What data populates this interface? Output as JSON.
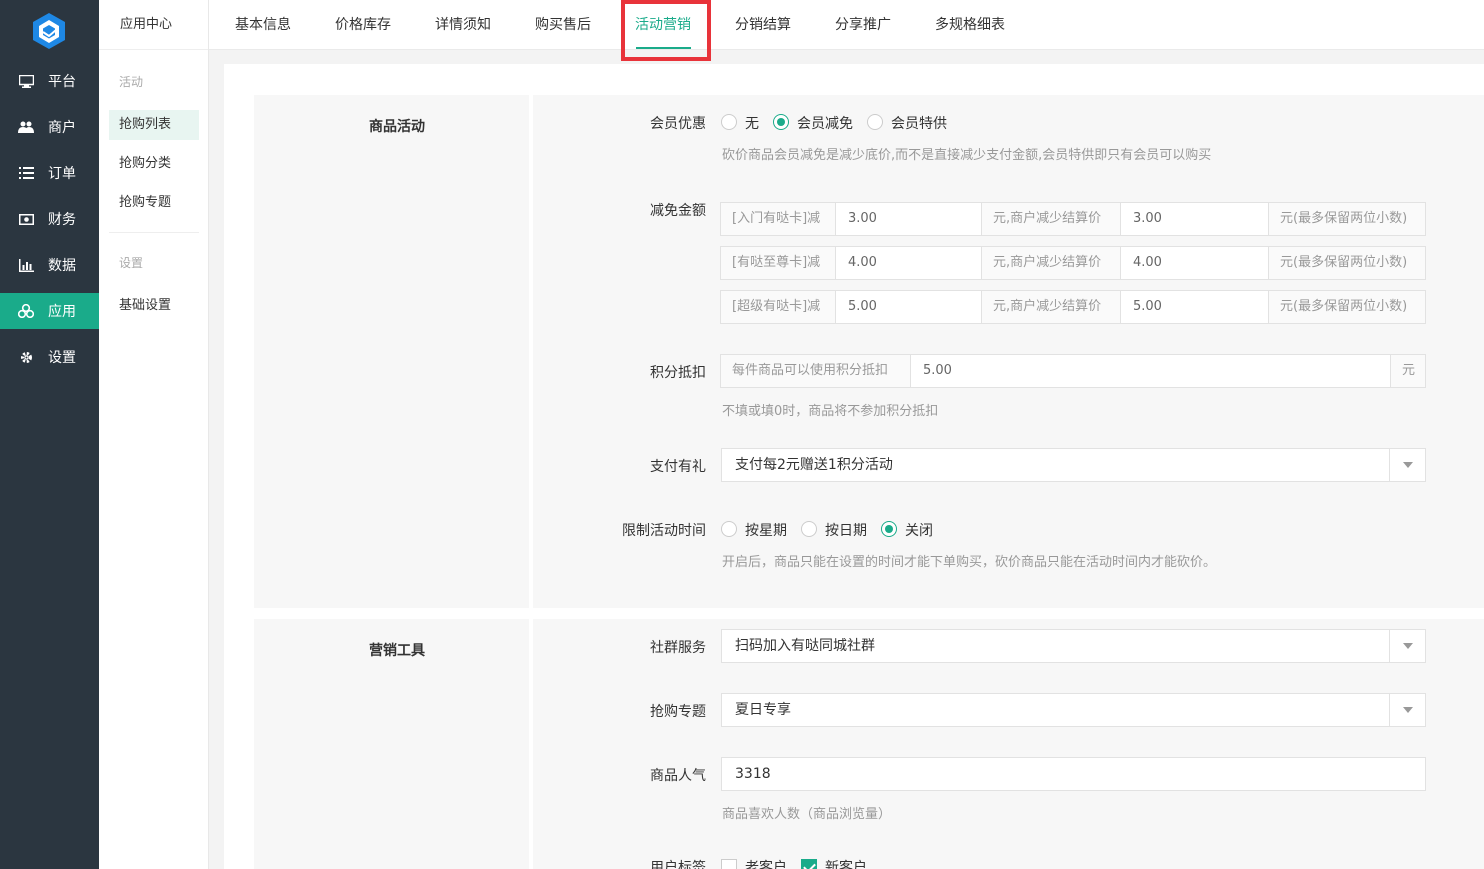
{
  "sidebar": {
    "items": [
      {
        "label": "平台",
        "icon": "monitor-icon"
      },
      {
        "label": "商户",
        "icon": "users-icon"
      },
      {
        "label": "订单",
        "icon": "list-icon"
      },
      {
        "label": "财务",
        "icon": "money-icon"
      },
      {
        "label": "数据",
        "icon": "bar-chart-icon"
      },
      {
        "label": "应用",
        "icon": "apps-icon",
        "active": true
      },
      {
        "label": "设置",
        "icon": "gear-icon"
      }
    ],
    "accent": "#1aab8a"
  },
  "subnav": {
    "title": "应用中心",
    "group1": "活动",
    "items1": [
      "抢购列表",
      "抢购分类",
      "抢购专题"
    ],
    "group2": "设置",
    "items2": [
      "基础设置"
    ]
  },
  "tabs": [
    "基本信息",
    "价格库存",
    "详情须知",
    "购买售后",
    "活动营销",
    "分销结算",
    "分享推广",
    "多规格细表"
  ],
  "activeTab": "活动营销",
  "section1": {
    "title": "商品活动",
    "member": {
      "label": "会员优惠",
      "options": [
        "无",
        "会员减免",
        "会员特供"
      ],
      "selected": "会员减免",
      "help": "砍价商品会员减免是减少底价,而不是直接减少支付金额,会员特供即只有会员可以购买"
    },
    "discount": {
      "label": "减免金额",
      "rows": [
        {
          "card": "[入门有哒卡]减",
          "amount": "3.00",
          "mid": "元,商户减少结算价",
          "settle": "3.00",
          "tail": "元(最多保留两位小数)"
        },
        {
          "card": "[有哒至尊卡]减",
          "amount": "4.00",
          "mid": "元,商户减少结算价",
          "settle": "4.00",
          "tail": "元(最多保留两位小数)"
        },
        {
          "card": "[超级有哒卡]减",
          "amount": "5.00",
          "mid": "元,商户减少结算价",
          "settle": "5.00",
          "tail": "元(最多保留两位小数)"
        }
      ]
    },
    "points": {
      "label": "积分抵扣",
      "prefix": "每件商品可以使用积分抵扣",
      "value": "5.00",
      "unit": "元",
      "help": "不填或填0时，商品将不参加积分抵扣"
    },
    "gift": {
      "label": "支付有礼",
      "value": "支付每2元赠送1积分活动"
    },
    "timeLimit": {
      "label": "限制活动时间",
      "options": [
        "按星期",
        "按日期",
        "关闭"
      ],
      "selected": "关闭",
      "help": "开启后，商品只能在设置的时间才能下单购买，砍价商品只能在活动时间内才能砍价。"
    }
  },
  "section2": {
    "title": "营销工具",
    "community": {
      "label": "社群服务",
      "value": "扫码加入有哒同城社群"
    },
    "topic": {
      "label": "抢购专题",
      "value": "夏日专享"
    },
    "popularity": {
      "label": "商品人气",
      "value": "3318",
      "help": "商品喜欢人数（商品浏览量）"
    },
    "userTag": {
      "label": "用户标签",
      "options": [
        "老客户",
        "新客户"
      ],
      "checked": [
        "新客户"
      ]
    }
  }
}
